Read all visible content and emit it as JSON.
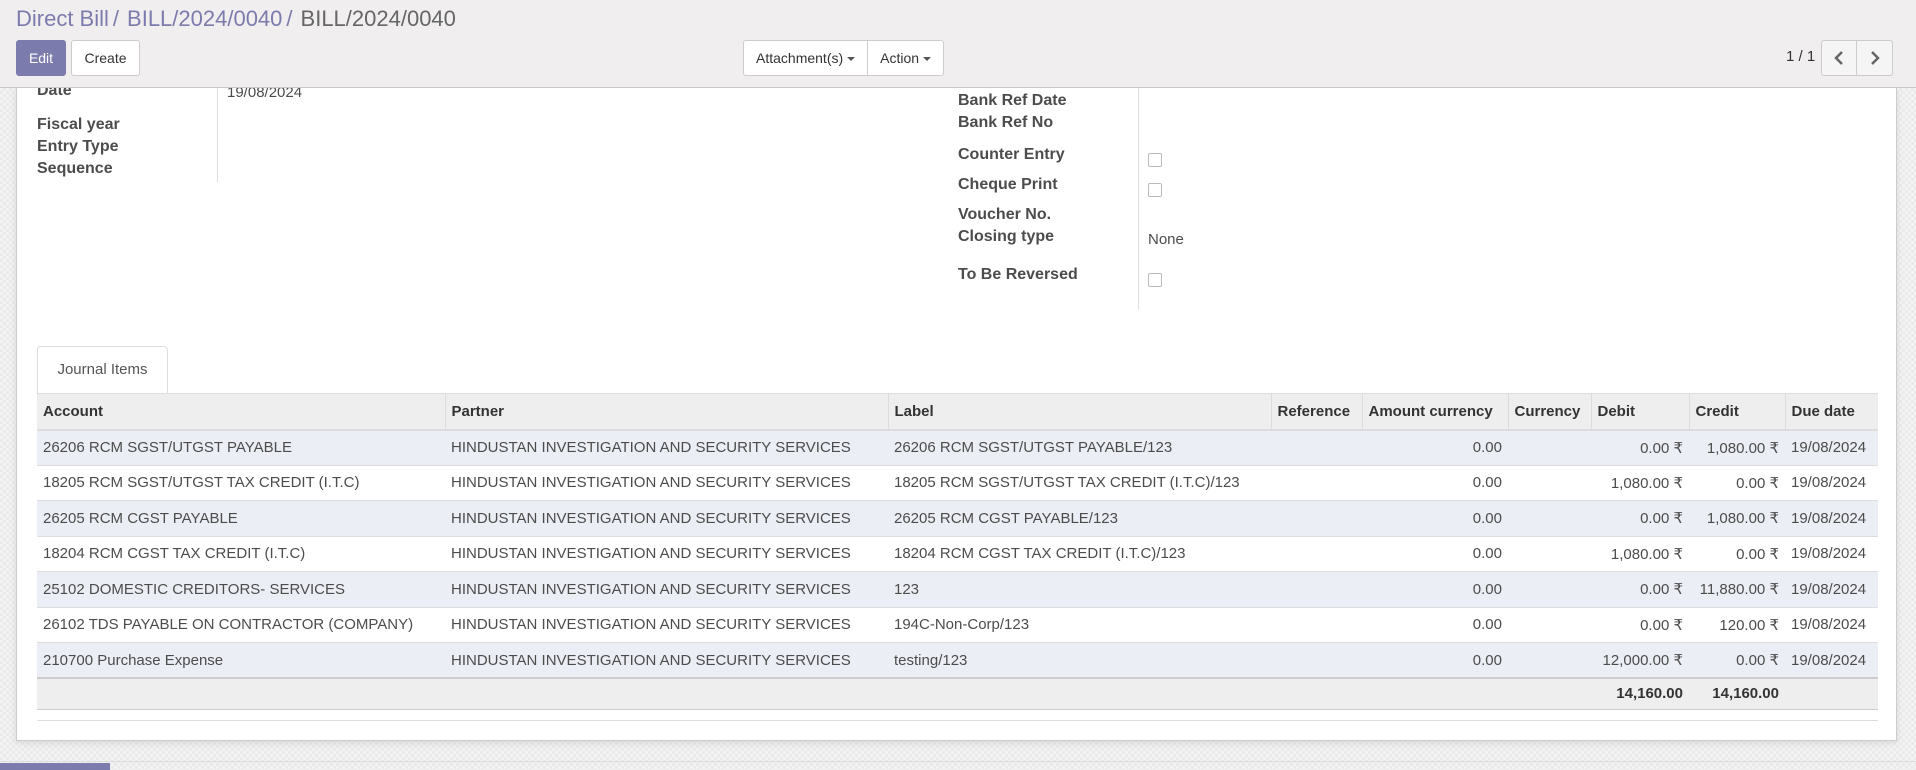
{
  "breadcrumb": {
    "items": [
      "Direct Bill",
      "BILL/2024/0040",
      "BILL/2024/0040"
    ],
    "separator": "/"
  },
  "toolbar": {
    "edit_label": "Edit",
    "create_label": "Create",
    "attachments_label": "Attachment(s)",
    "action_label": "Action"
  },
  "pager": {
    "value": "1 / 1"
  },
  "form": {
    "left": {
      "date_label": "Date",
      "date_value": "19/08/2024",
      "fiscal_year_label": "Fiscal year",
      "entry_type_label": "Entry Type",
      "sequence_label": "Sequence"
    },
    "right": {
      "bank_ref_date_label": "Bank Ref Date",
      "bank_ref_no_label": "Bank Ref No",
      "counter_entry_label": "Counter Entry",
      "counter_entry_checked": false,
      "cheque_print_label": "Cheque Print",
      "cheque_print_checked": false,
      "voucher_no_label": "Voucher No.",
      "closing_type_label": "Closing type",
      "closing_type_value": "None",
      "to_be_reversed_label": "To Be Reversed",
      "to_be_reversed_checked": false
    }
  },
  "tabs": [
    {
      "label": "Journal Items",
      "active": true
    }
  ],
  "journal": {
    "columns": [
      "Account",
      "Partner",
      "Label",
      "Reference",
      "Amount currency",
      "Currency",
      "Debit",
      "Credit",
      "Due date"
    ],
    "rows": [
      [
        "26206 RCM SGST/UTGST PAYABLE",
        "HINDUSTAN INVESTIGATION AND SECURITY SERVICES",
        "26206 RCM SGST/UTGST PAYABLE/123",
        "",
        "0.00",
        "",
        "0.00 ₹",
        "1,080.00 ₹",
        "19/08/2024"
      ],
      [
        "18205 RCM SGST/UTGST TAX CREDIT (I.T.C)",
        "HINDUSTAN INVESTIGATION AND SECURITY SERVICES",
        "18205 RCM SGST/UTGST TAX CREDIT (I.T.C)/123",
        "",
        "0.00",
        "",
        "1,080.00 ₹",
        "0.00 ₹",
        "19/08/2024"
      ],
      [
        "26205 RCM CGST PAYABLE",
        "HINDUSTAN INVESTIGATION AND SECURITY SERVICES",
        "26205 RCM CGST PAYABLE/123",
        "",
        "0.00",
        "",
        "0.00 ₹",
        "1,080.00 ₹",
        "19/08/2024"
      ],
      [
        "18204 RCM CGST TAX CREDIT (I.T.C)",
        "HINDUSTAN INVESTIGATION AND SECURITY SERVICES",
        "18204 RCM CGST TAX CREDIT (I.T.C)/123",
        "",
        "0.00",
        "",
        "1,080.00 ₹",
        "0.00 ₹",
        "19/08/2024"
      ],
      [
        "25102 DOMESTIC CREDITORS- SERVICES",
        "HINDUSTAN INVESTIGATION AND SECURITY SERVICES",
        "123",
        "",
        "0.00",
        "",
        "0.00 ₹",
        "11,880.00 ₹",
        "19/08/2024"
      ],
      [
        "26102 TDS PAYABLE ON CONTRACTOR (COMPANY)",
        "HINDUSTAN INVESTIGATION AND SECURITY SERVICES",
        "194C-Non-Corp/123",
        "",
        "0.00",
        "",
        "0.00 ₹",
        "120.00 ₹",
        "19/08/2024"
      ],
      [
        "210700 Purchase Expense",
        "HINDUSTAN INVESTIGATION AND SECURITY SERVICES",
        "testing/123",
        "",
        "0.00",
        "",
        "12,000.00 ₹",
        "0.00 ₹",
        "19/08/2024"
      ]
    ],
    "totals": {
      "debit": "14,160.00",
      "credit": "14,160.00"
    }
  },
  "colors": {
    "brand": "#7c7bad",
    "row_stripe": "#eceef6",
    "header_bg": "#eeeeee"
  }
}
